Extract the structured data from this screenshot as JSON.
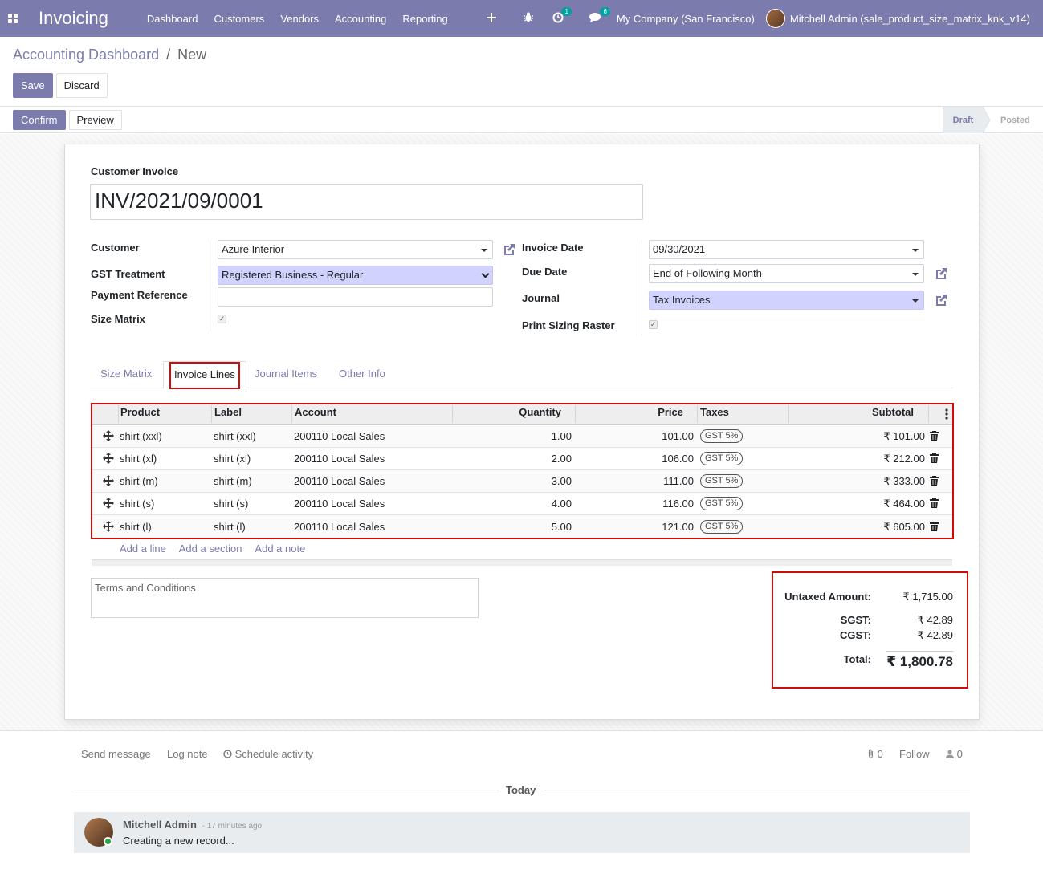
{
  "navbar": {
    "app_name": "Invoicing",
    "menu": [
      "Dashboard",
      "Customers",
      "Vendors",
      "Accounting",
      "Reporting"
    ],
    "activity_count": "1",
    "message_count": "6",
    "company": "My Company (San Francisco)",
    "user": "Mitchell Admin (sale_product_size_matrix_knk_v14)"
  },
  "breadcrumb": {
    "parent": "Accounting Dashboard",
    "separator": "/",
    "current": "New"
  },
  "buttons": {
    "save": "Save",
    "discard": "Discard",
    "confirm": "Confirm",
    "preview": "Preview"
  },
  "status": {
    "draft": "Draft",
    "posted": "Posted"
  },
  "form": {
    "doc_type": "Customer Invoice",
    "number": "INV/2021/09/0001",
    "customer_label": "Customer",
    "customer_value": "Azure Interior",
    "gst_label": "GST Treatment",
    "gst_value": "Registered Business - Regular",
    "payment_ref_label": "Payment Reference",
    "payment_ref_value": "",
    "size_matrix_label": "Size Matrix",
    "invoice_date_label": "Invoice Date",
    "invoice_date_value": "09/30/2021",
    "due_date_label": "Due Date",
    "due_date_value": "End of Following Month",
    "journal_label": "Journal",
    "journal_value": "Tax Invoices",
    "print_raster_label": "Print Sizing Raster"
  },
  "tabs": [
    "Size Matrix",
    "Invoice Lines",
    "Journal Items",
    "Other Info"
  ],
  "table": {
    "headers": {
      "product": "Product",
      "label": "Label",
      "account": "Account",
      "quantity": "Quantity",
      "price": "Price",
      "taxes": "Taxes",
      "subtotal": "Subtotal"
    },
    "rows": [
      {
        "product": "shirt (xxl)",
        "label": "shirt (xxl)",
        "account": "200110 Local Sales",
        "quantity": "1.00",
        "price": "101.00",
        "tax": "GST 5%",
        "subtotal": "₹ 101.00"
      },
      {
        "product": "shirt (xl)",
        "label": "shirt (xl)",
        "account": "200110 Local Sales",
        "quantity": "2.00",
        "price": "106.00",
        "tax": "GST 5%",
        "subtotal": "₹ 212.00"
      },
      {
        "product": "shirt (m)",
        "label": "shirt (m)",
        "account": "200110 Local Sales",
        "quantity": "3.00",
        "price": "111.00",
        "tax": "GST 5%",
        "subtotal": "₹ 333.00"
      },
      {
        "product": "shirt (s)",
        "label": "shirt (s)",
        "account": "200110 Local Sales",
        "quantity": "4.00",
        "price": "116.00",
        "tax": "GST 5%",
        "subtotal": "₹ 464.00"
      },
      {
        "product": "shirt (l)",
        "label": "shirt (l)",
        "account": "200110 Local Sales",
        "quantity": "5.00",
        "price": "121.00",
        "tax": "GST 5%",
        "subtotal": "₹ 605.00"
      }
    ],
    "add_line": "Add a line",
    "add_section": "Add a section",
    "add_note": "Add a note"
  },
  "terms_placeholder": "Terms and Conditions",
  "totals": {
    "untaxed_label": "Untaxed Amount:",
    "untaxed_value": "₹ 1,715.00",
    "sgst_label": "SGST:",
    "sgst_value": "₹ 42.89",
    "cgst_label": "CGST:",
    "cgst_value": "₹ 42.89",
    "total_label": "Total:",
    "total_value": "₹ 1,800.78"
  },
  "chatter": {
    "send_message": "Send message",
    "log_note": "Log note",
    "schedule_activity": "Schedule activity",
    "attachments": "0",
    "follow": "Follow",
    "followers": "0",
    "today": "Today",
    "author": "Mitchell Admin",
    "time": "- 17 minutes ago",
    "body": "Creating a new record..."
  },
  "colors": {
    "brand": "#7c7bad",
    "required_field": "#d2d2ff",
    "highlight": "#d10a0a"
  }
}
